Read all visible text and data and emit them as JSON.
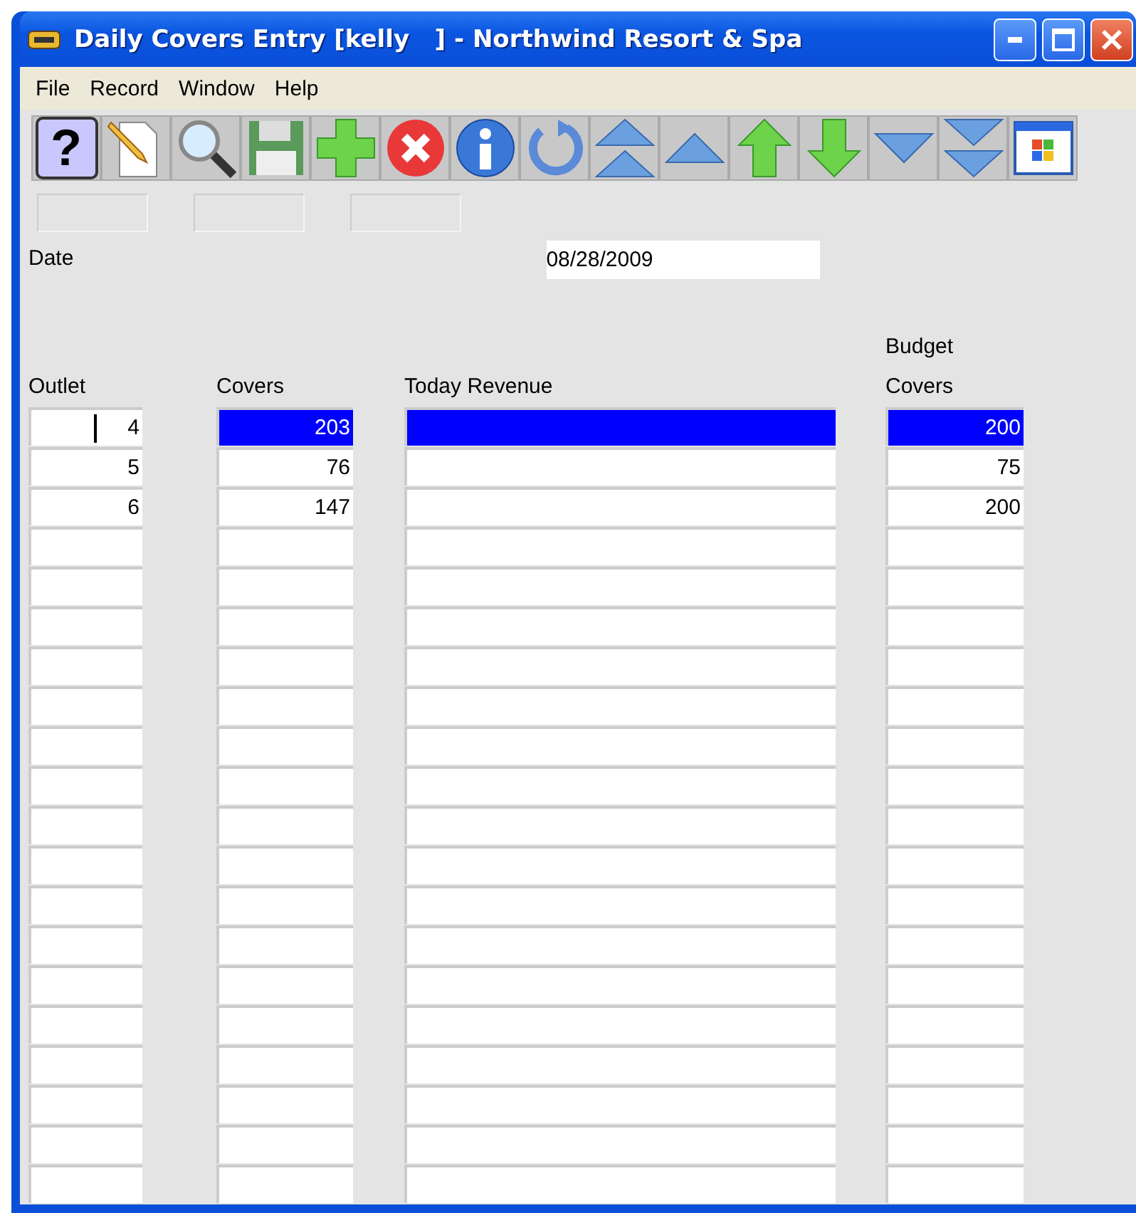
{
  "window": {
    "title": "Daily Covers Entry [kelly   ] - Northwind Resort & Spa"
  },
  "menu": [
    "File",
    "Record",
    "Window",
    "Help"
  ],
  "toolbar": [
    {
      "kind": "help",
      "label": "?"
    },
    {
      "kind": "new"
    },
    {
      "kind": "search"
    },
    {
      "kind": "save"
    },
    {
      "kind": "add"
    },
    {
      "kind": "delete"
    },
    {
      "kind": "info"
    },
    {
      "kind": "refresh"
    },
    {
      "kind": "first"
    },
    {
      "kind": "prev"
    },
    {
      "kind": "up"
    },
    {
      "kind": "down"
    },
    {
      "kind": "next"
    },
    {
      "kind": "last"
    },
    {
      "kind": "window"
    }
  ],
  "date": {
    "label": "Date",
    "value": "08/28/2009"
  },
  "table": {
    "columns": [
      "Outlet",
      "Covers",
      "Today Revenue",
      "Budget\nCovers"
    ],
    "rows": [
      {
        "outlet": "4",
        "covers": "203",
        "budget": "200",
        "selected": true
      },
      {
        "outlet": "5",
        "covers": "76",
        "budget": "75",
        "selected": false
      },
      {
        "outlet": "6",
        "covers": "147",
        "budget": "200",
        "selected": false
      }
    ]
  }
}
